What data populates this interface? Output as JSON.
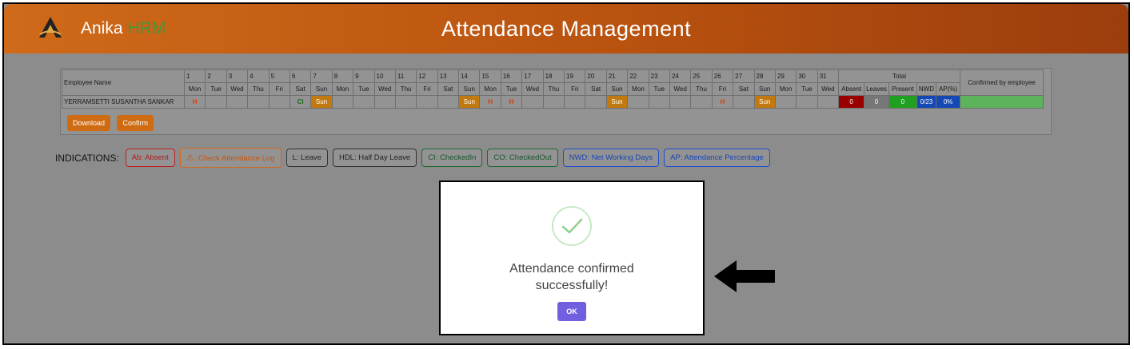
{
  "app": {
    "brand_main": "Anika",
    "brand_accent": "HRM",
    "page_title": "Attendance Management"
  },
  "colors": {
    "header": "#c25d14",
    "sunday": "#c27a10",
    "absent": "#9b0000",
    "present": "#20a020",
    "nwd": "#1448b5",
    "ok_button": "#7060e0",
    "check": "#8fd18f"
  },
  "table": {
    "employee_header": "Employee Name",
    "days": [
      "1",
      "2",
      "3",
      "4",
      "5",
      "6",
      "7",
      "8",
      "9",
      "10",
      "11",
      "12",
      "13",
      "14",
      "15",
      "16",
      "17",
      "18",
      "19",
      "20",
      "21",
      "22",
      "23",
      "24",
      "25",
      "26",
      "27",
      "28",
      "29",
      "30",
      "31"
    ],
    "weekdays": [
      "Mon",
      "Tue",
      "Wed",
      "Thu",
      "Fri",
      "Sat",
      "Sun",
      "Mon",
      "Tue",
      "Wed",
      "Thu",
      "Fri",
      "Sat",
      "Sun",
      "Mon",
      "Tue",
      "Wed",
      "Thu",
      "Fri",
      "Sat",
      "Sun",
      "Mon",
      "Tue",
      "Wed",
      "Thu",
      "Fri",
      "Sat",
      "Sun",
      "Mon",
      "Tue",
      "Wed"
    ],
    "total_header": "Total",
    "total_cols": [
      "Absent",
      "Leaves",
      "Present",
      "NWD",
      "AP(%)"
    ],
    "confirmed_header": "Confirmed by employee",
    "row": {
      "employee": "YERRAMSETTI SUSANTHA SANKAR",
      "cells": [
        "H",
        "",
        "",
        "",
        "",
        "CI",
        "Sun",
        "",
        "",
        "",
        "",
        "",
        "",
        "Sun",
        "H",
        "H",
        "",
        "",
        "",
        "",
        "Sun",
        "",
        "",
        "",
        "",
        "H",
        "",
        "Sun",
        "",
        "",
        ""
      ],
      "absent": "0",
      "leaves": "0",
      "present": "0",
      "nwd": "0/23",
      "ap": "0%",
      "confirmed": ""
    }
  },
  "buttons": {
    "download": "Download",
    "confirm": "Confirm"
  },
  "indications": {
    "label": "INDICATIONS:",
    "items": [
      {
        "text": "Ab: Absent",
        "style": "red"
      },
      {
        "text": ": Check Attendance Log",
        "style": "orange",
        "icon": "warning-icon"
      },
      {
        "text": "L: Leave",
        "style": "gray"
      },
      {
        "text": "HDL: Half Day Leave",
        "style": "gray"
      },
      {
        "text": "CI: CheckedIn",
        "style": "green"
      },
      {
        "text": "CO: CheckedOut",
        "style": "green"
      },
      {
        "text": "NWD: Net Working Days",
        "style": "blue"
      },
      {
        "text": "AP: Attendance Percentage",
        "style": "blue"
      }
    ]
  },
  "dialog": {
    "icon": "success-check-icon",
    "message": "Attendance confirmed successfully!",
    "ok_label": "OK"
  },
  "annotation": {
    "icon": "left-arrow-icon"
  }
}
